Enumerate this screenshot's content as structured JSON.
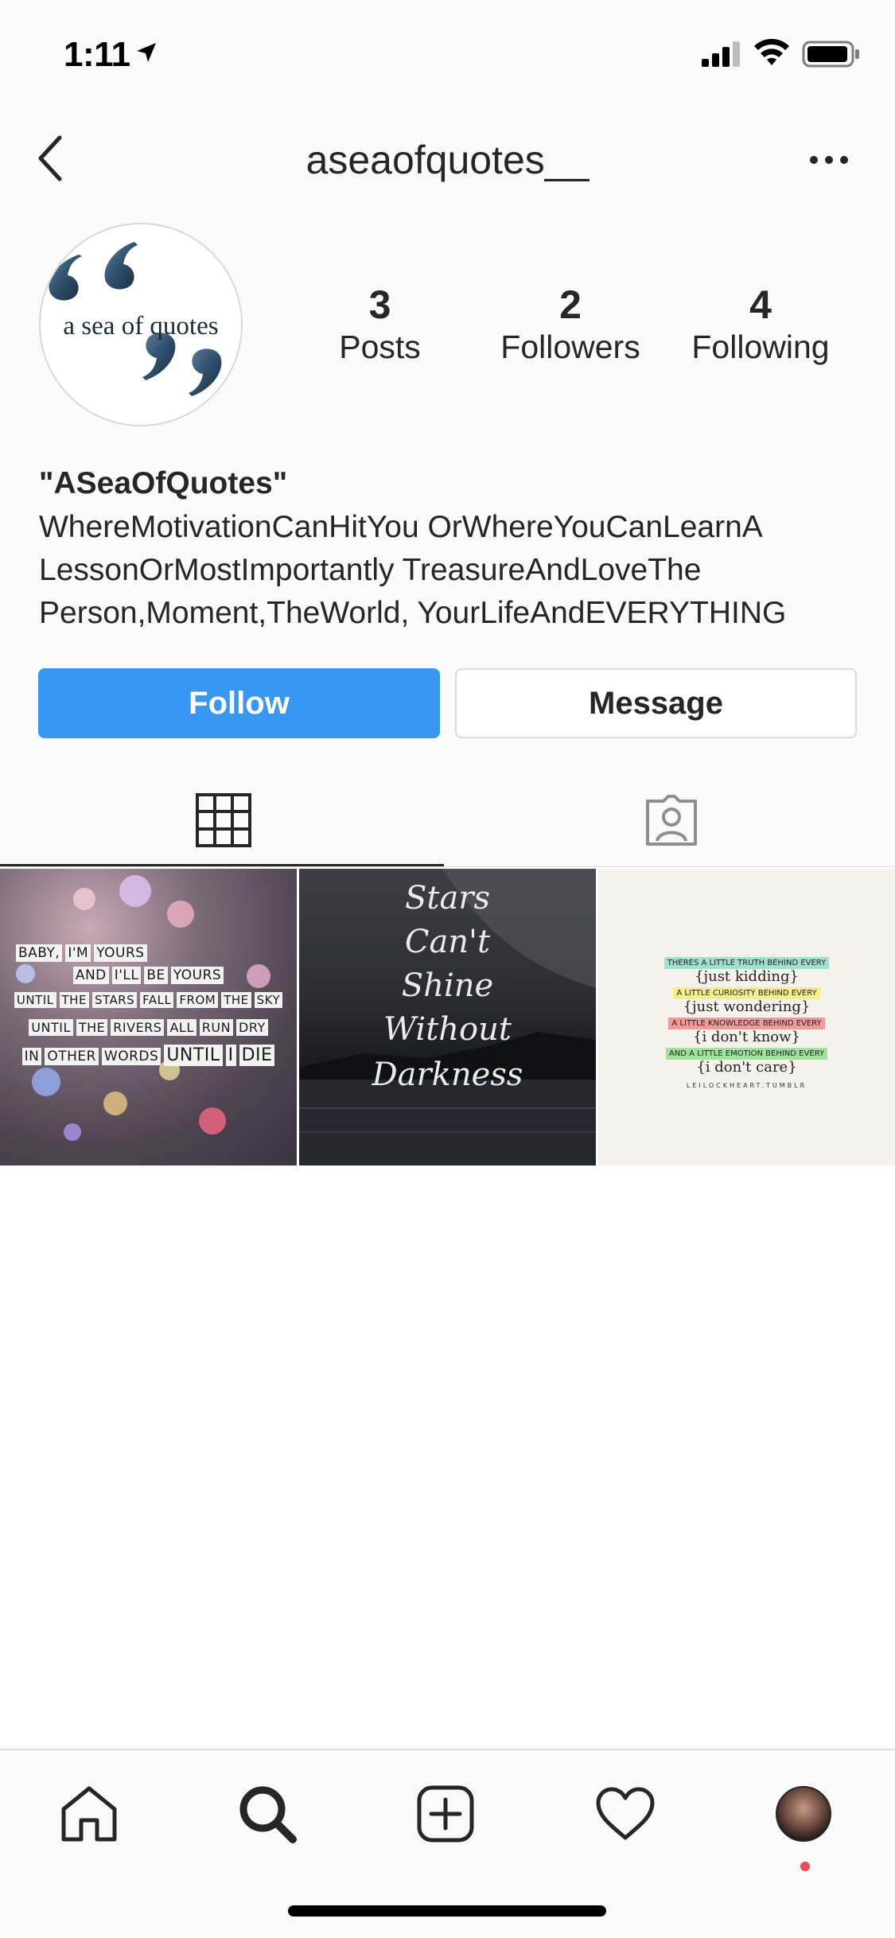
{
  "status_bar": {
    "time": "1:11",
    "icons": [
      "location-arrow-icon",
      "cellular-signal-icon",
      "wifi-icon",
      "battery-icon"
    ]
  },
  "nav": {
    "title": "aseaofquotes__",
    "back_icon": "chevron-left-icon",
    "more_icon": "more-horizontal-icon"
  },
  "profile": {
    "avatar_text": "a sea of quotes",
    "stats": {
      "posts": {
        "count": "3",
        "label": "Posts"
      },
      "followers": {
        "count": "2",
        "label": "Followers"
      },
      "following": {
        "count": "4",
        "label": "Following"
      }
    },
    "name": "\"ASeaOfQuotes\"",
    "bio_lines": [
      "WhereMotivationCanHitYou OrWhereYouCanLearnA",
      "LessonOrMostImportantly TreasureAndLoveThe",
      "Person,Moment,TheWorld, YourLifeAndEVERYTHING"
    ]
  },
  "actions": {
    "follow_label": "Follow",
    "message_label": "Message"
  },
  "tabs": [
    {
      "name": "grid",
      "icon": "grid-icon",
      "active": true
    },
    {
      "name": "tagged",
      "icon": "tagged-person-icon",
      "active": false
    }
  ],
  "posts": {
    "post1": {
      "lines": [
        [
          "BABY,",
          "I'M",
          "YOURS"
        ],
        [
          "AND",
          "I'LL",
          "BE",
          "YOURS"
        ],
        [
          "UNTIL",
          "THE",
          "STARS",
          "FALL",
          "FROM",
          "THE",
          "SKY"
        ],
        [
          "UNTIL",
          "THE",
          "RIVERS",
          "ALL",
          "RUN",
          "DRY"
        ],
        [
          "IN",
          "OTHER",
          "WORDS",
          "UNTIL",
          "I",
          "DIE"
        ]
      ]
    },
    "post2": {
      "lines": [
        "Stars",
        "Can't",
        "Shine",
        "Without",
        "Darkness"
      ]
    },
    "post3": {
      "rows": [
        {
          "small": "THERES A LITTLE TRUTH BEHIND EVERY",
          "big": "{just kidding}",
          "color": "#9fe0d0"
        },
        {
          "small": "A LITTLE CURIOSITY BEHIND EVERY",
          "big": "{just wondering}",
          "color": "#f3ef8a"
        },
        {
          "small": "A LITTLE KNOWLEDGE BEHIND EVERY",
          "big": "{i don't know}",
          "color": "#f29a9a"
        },
        {
          "small": "AND A LITTLE EMOTION BEHIND EVERY",
          "big": "{i don't care}",
          "color": "#9fe39a"
        }
      ],
      "footer": "LEILOCKHEART.TUMBLR"
    }
  },
  "bottom_nav": {
    "items": [
      "home-icon",
      "search-icon",
      "add-post-icon",
      "heart-icon",
      "profile-avatar"
    ],
    "accent": "#3897f0",
    "notification_color": "#ed4956"
  }
}
